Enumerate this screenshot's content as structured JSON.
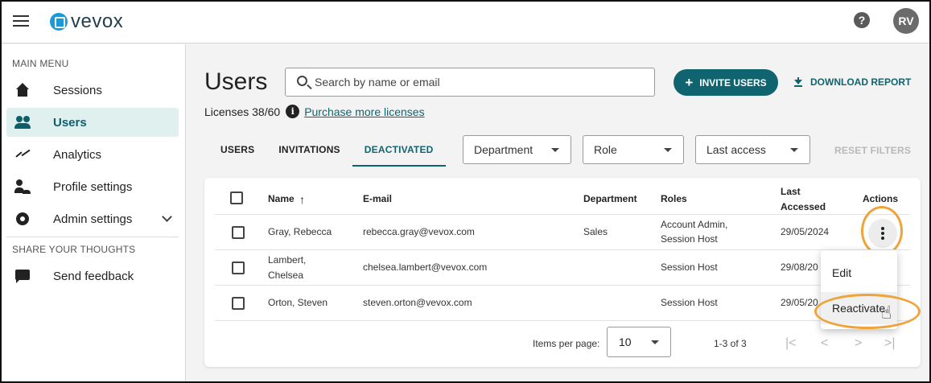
{
  "app": {
    "logo_text": "vevox",
    "user_initials": "RV",
    "help_symbol": "?"
  },
  "sidebar": {
    "main_menu_heading": "MAIN MENU",
    "items": [
      {
        "label": "Sessions",
        "icon": "home-icon"
      },
      {
        "label": "Users",
        "icon": "users-icon",
        "active": true
      },
      {
        "label": "Analytics",
        "icon": "analytics-icon"
      },
      {
        "label": "Profile settings",
        "icon": "profile-settings-icon"
      },
      {
        "label": "Admin settings",
        "icon": "gear-icon",
        "expandable": true
      }
    ],
    "share_heading": "SHARE YOUR THOUGHTS",
    "feedback_label": "Send feedback"
  },
  "page": {
    "title": "Users",
    "search_placeholder": "Search by name or email",
    "invite_label": "INVITE USERS",
    "download_label": "DOWNLOAD REPORT",
    "licenses_text": "Licenses 38/60",
    "purchase_link": "Purchase more licenses",
    "accent_color": "#0f6470"
  },
  "tabs": [
    {
      "label": "USERS"
    },
    {
      "label": "INVITATIONS"
    },
    {
      "label": "DEACTIVATED",
      "active": true
    }
  ],
  "filters": {
    "department": "Department",
    "role": "Role",
    "last_access": "Last access",
    "reset": "RESET FILTERS"
  },
  "table": {
    "headers": {
      "name": "Name",
      "sort_arrow": "↑",
      "email": "E-mail",
      "department": "Department",
      "roles": "Roles",
      "last_accessed_1": "Last",
      "last_accessed_2": "Accessed",
      "actions": "Actions"
    },
    "rows": [
      {
        "name_1": "Gray, Rebecca",
        "name_2": "",
        "email": "rebecca.gray@vevox.com",
        "department": "Sales",
        "roles_1": "Account Admin,",
        "roles_2": "Session Host",
        "last_accessed": "29/05/2024"
      },
      {
        "name_1": "Lambert,",
        "name_2": "Chelsea",
        "email": "chelsea.lambert@vevox.com",
        "department": "",
        "roles_1": "Session Host",
        "roles_2": "",
        "last_accessed": "29/08/20"
      },
      {
        "name_1": "Orton, Steven",
        "name_2": "",
        "email": "steven.orton@vevox.com",
        "department": "",
        "roles_1": "Session Host",
        "roles_2": "",
        "last_accessed": "29/05/20"
      }
    ]
  },
  "pagination": {
    "items_per_page_label": "Items per page:",
    "items_per_page_value": "10",
    "range": "1-3 of 3",
    "first": "|<",
    "prev": "<",
    "next": ">",
    "last": ">|"
  },
  "action_menu": {
    "edit": "Edit",
    "reactivate": "Reactivate"
  },
  "highlight_color": "#eea43a"
}
